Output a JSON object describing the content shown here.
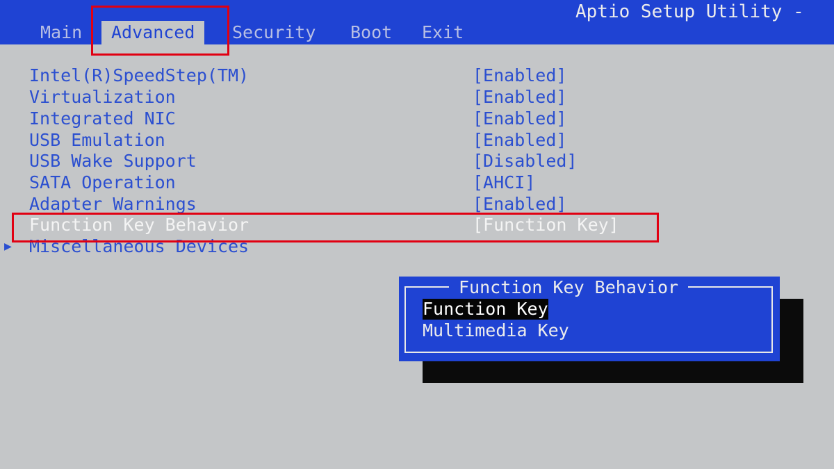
{
  "header": {
    "title": "Aptio Setup Utility -",
    "tabs": [
      {
        "label": "Main"
      },
      {
        "label": "Advanced"
      },
      {
        "label": "Security"
      },
      {
        "label": "Boot"
      },
      {
        "label": "Exit"
      }
    ],
    "active_tab": "Advanced"
  },
  "settings": [
    {
      "label": "Intel(R)SpeedStep(TM)",
      "value": "[Enabled]"
    },
    {
      "label": "Virtualization",
      "value": "[Enabled]"
    },
    {
      "label": "Integrated NIC",
      "value": "[Enabled]"
    },
    {
      "label": "USB Emulation",
      "value": "[Enabled]"
    },
    {
      "label": "USB Wake Support",
      "value": "[Disabled]"
    },
    {
      "label": "SATA Operation",
      "value": "[AHCI]"
    },
    {
      "label": "Adapter Warnings",
      "value": "[Enabled]"
    },
    {
      "label": "Function Key Behavior",
      "value": "[Function Key]"
    },
    {
      "label": "Miscellaneous Devices",
      "value": ""
    }
  ],
  "selected_setting": "Function Key Behavior",
  "submenu_arrow": "▶",
  "popup": {
    "title": "Function Key Behavior",
    "options": [
      "Function Key",
      "Multimedia Key"
    ],
    "selected": "Function Key"
  },
  "colors": {
    "header_bg": "#1f43d3",
    "body_bg": "#c4c6c8",
    "item_text": "#2b4fd0",
    "highlight_outline": "#e10012",
    "popup_bg": "#1f43d3",
    "popup_shadow": "#0b0b0b"
  }
}
